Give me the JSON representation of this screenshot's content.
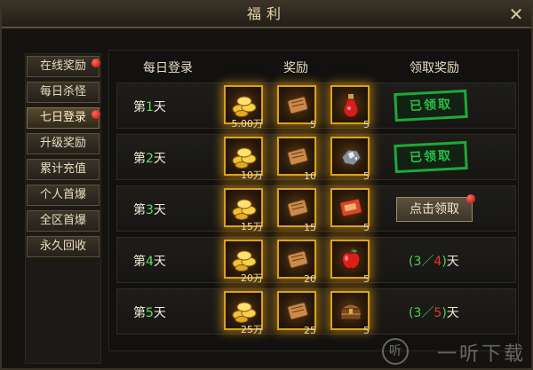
{
  "window": {
    "title": "福利",
    "close_glyph": "✕"
  },
  "sidebar": {
    "items": [
      {
        "label": "在线奖励",
        "dot": true,
        "active": false
      },
      {
        "label": "每日杀怪",
        "dot": false,
        "active": false
      },
      {
        "label": "七日登录",
        "dot": true,
        "active": true
      },
      {
        "label": "升级奖励",
        "dot": false,
        "active": false
      },
      {
        "label": "累计充值",
        "dot": false,
        "active": false
      },
      {
        "label": "个人首爆",
        "dot": false,
        "active": false
      },
      {
        "label": "全区首爆",
        "dot": false,
        "active": false
      },
      {
        "label": "永久回收",
        "dot": false,
        "active": false
      }
    ]
  },
  "table": {
    "headers": {
      "day": "每日登录",
      "reward": "奖励",
      "claim": "领取奖励"
    },
    "rows": [
      {
        "day_prefix": "第",
        "day_num": "1",
        "day_suffix": "天",
        "rewards": [
          {
            "icon": "gold-coins-icon",
            "qty": "5.00万"
          },
          {
            "icon": "scroll-icon",
            "qty": "5"
          },
          {
            "icon": "red-potion-icon",
            "qty": "5"
          }
        ],
        "status": "claimed",
        "status_text": "已领取"
      },
      {
        "day_prefix": "第",
        "day_num": "2",
        "day_suffix": "天",
        "rewards": [
          {
            "icon": "gold-coins-icon",
            "qty": "10万"
          },
          {
            "icon": "scroll-icon",
            "qty": "10"
          },
          {
            "icon": "diamond-ore-icon",
            "qty": "5"
          }
        ],
        "status": "claimed",
        "status_text": "已领取"
      },
      {
        "day_prefix": "第",
        "day_num": "3",
        "day_suffix": "天",
        "rewards": [
          {
            "icon": "gold-coins-icon",
            "qty": "15万"
          },
          {
            "icon": "scroll-icon",
            "qty": "15"
          },
          {
            "icon": "red-book-icon",
            "qty": "5"
          }
        ],
        "status": "claimable",
        "status_text": "点击领取"
      },
      {
        "day_prefix": "第",
        "day_num": "4",
        "day_suffix": "天",
        "rewards": [
          {
            "icon": "gold-coins-icon",
            "qty": "20万"
          },
          {
            "icon": "scroll-icon",
            "qty": "20"
          },
          {
            "icon": "red-apple-icon",
            "qty": "5"
          }
        ],
        "status": "progress",
        "progress": {
          "open": "(",
          "done": "3",
          "slash": "／",
          "total": "4",
          "close": ")",
          "unit": "天"
        }
      },
      {
        "day_prefix": "第",
        "day_num": "5",
        "day_suffix": "天",
        "rewards": [
          {
            "icon": "gold-coins-icon",
            "qty": "25万"
          },
          {
            "icon": "scroll-icon",
            "qty": "25"
          },
          {
            "icon": "treasure-chest-icon",
            "qty": "5"
          }
        ],
        "status": "progress",
        "progress": {
          "open": "(",
          "done": "3",
          "slash": "／",
          "total": "5",
          "close": ")",
          "unit": "天"
        }
      }
    ]
  },
  "watermark": {
    "logo": "听",
    "text": "一听下载"
  },
  "colors": {
    "accent_gold": "#d9a21c",
    "day_number": "#5ce05c",
    "stamp_green": "#24c044",
    "dot_red": "#c00a0a"
  }
}
